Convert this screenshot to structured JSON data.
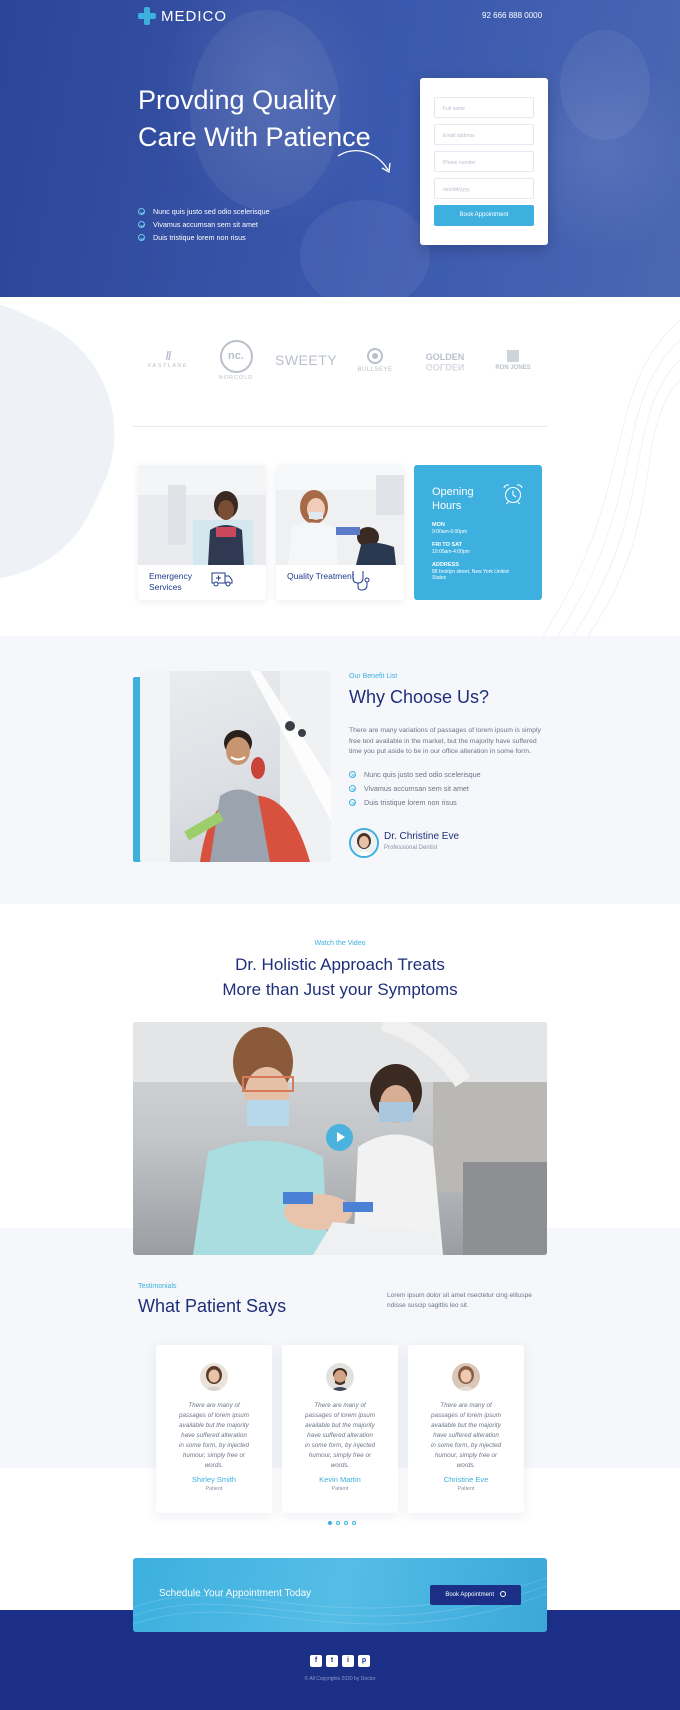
{
  "header": {
    "logo": "MEDICO",
    "phone": "92 666 888 0000"
  },
  "hero": {
    "title": "Provding Quality Care With Patience",
    "checklist": [
      "Nunc quis justo sed odio scelerisque",
      "Vivamus accumsan sem sit amet",
      "Duis tristique lorem non risus"
    ]
  },
  "form": {
    "name_placeholder": "Full name",
    "email_placeholder": "Email address",
    "phone_placeholder": "Phone number",
    "date_placeholder": "mm/dd/yyyy",
    "button": "Book Appointment"
  },
  "brands": [
    "FASTLANE",
    "nc.",
    "NORCOLD",
    "SWEETY",
    "BULLSEYE",
    "GOLDEN",
    "RON JONES"
  ],
  "services": [
    {
      "label": "Emergency Services",
      "icon": "ambulance-icon"
    },
    {
      "label": "Quality Treatment",
      "icon": "stethoscope-icon"
    }
  ],
  "hours": {
    "title": "Opening Hours",
    "mon_label": "MON",
    "mon_value": "9:00am-6:00pm",
    "frisat_label": "FRI TO SAT",
    "frisat_value": "10:00am-4:00pm",
    "address_label": "ADDRESS",
    "address_value": "88 broklyn street, New York United States"
  },
  "why": {
    "tag": "Our Benefit List",
    "title": "Why Choose Us?",
    "text": "There are many variations of passages of lorem ipsum is simply free text available in the market, but the majority have suffered time you put aside to be in our office alteration in some form.",
    "checklist": [
      "Nunc quis justo sed odio scelerisque",
      "Vivamus accumsan sem sit amet",
      "Duis tristique lorem non risus"
    ],
    "doctor_name": "Dr. Christine Eve",
    "doctor_role": "Professional Dentist"
  },
  "video": {
    "tag": "Watch the Video",
    "title_line1": "Dr. Holistic Approach Treats",
    "title_line2": "More than Just your Symptoms"
  },
  "testimonials": {
    "tag": "Testimonials",
    "title": "What Patient Says",
    "text": "Lorem ipsum dolor sit amet nsectetur cing elituspe ndisse suscip sagittis leo sit.",
    "items": [
      {
        "quote": "There are many of passages of lorem ipsum available but the majority have suffered alteration in some form, by injected humour, simply free or words.",
        "name": "Shirley Smith",
        "role": "Patient"
      },
      {
        "quote": "There are many of passages of lorem ipsum available but the majority have suffered alteration in some form, by injected humour, simply free or words.",
        "name": "Kevin Martin",
        "role": "Patient"
      },
      {
        "quote": "There are many of passages of lorem ipsum available but the majority have suffered alteration in some form, by injected humour, simply free or words.",
        "name": "Christine Eve",
        "role": "Patient"
      }
    ]
  },
  "cta": {
    "text": "Schedule Your Appointment Today",
    "button": "Book Appointment"
  },
  "footer": {
    "social": [
      "f",
      "t",
      "i",
      "p"
    ],
    "copyright": "© All Copyrights 2020 by Doctor"
  },
  "colors": {
    "primary_blue": "#3db0df",
    "navy": "#1b2f86",
    "hero_blue": "#3a58ad"
  }
}
